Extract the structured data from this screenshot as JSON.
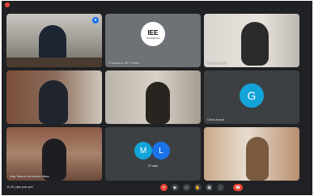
{
  "participants": [
    {
      "label": "Presidencia IEE Puebla"
    },
    {
      "label": "Claudia Garate"
    },
    {
      "label": "Gloria Aurora",
      "initial": "G",
      "color": "#12a4d9"
    },
    {
      "label": "Mag. Blanca Hernández Meza"
    },
    {
      "label": "27 más",
      "initials": [
        "M",
        "L"
      ],
      "colors": [
        "#12a4d9",
        "#1a73e8"
      ]
    }
  ],
  "logo": {
    "text": "IEE",
    "subtext": "Presidencia"
  },
  "meeting": {
    "time": "11:25",
    "separator": "|",
    "code": "dpe-yosr-ycd"
  },
  "controls": [
    {
      "name": "mic-off",
      "icon": "mic-off-icon",
      "glyph": "✕"
    },
    {
      "name": "camera",
      "icon": "camera-icon",
      "glyph": "▶"
    },
    {
      "name": "captions",
      "icon": "captions-icon",
      "glyph": "▭"
    },
    {
      "name": "raise-hand",
      "icon": "hand-icon",
      "glyph": "✋"
    },
    {
      "name": "present",
      "icon": "present-icon",
      "glyph": "▣"
    },
    {
      "name": "more",
      "icon": "more-icon",
      "glyph": "⋮"
    },
    {
      "name": "leave-call",
      "icon": "leave-call-icon",
      "glyph": "☎"
    }
  ],
  "colors": {
    "background": "#202124",
    "tile": "#3c4043",
    "accent": "#1a73e8",
    "danger": "#ea4335"
  }
}
